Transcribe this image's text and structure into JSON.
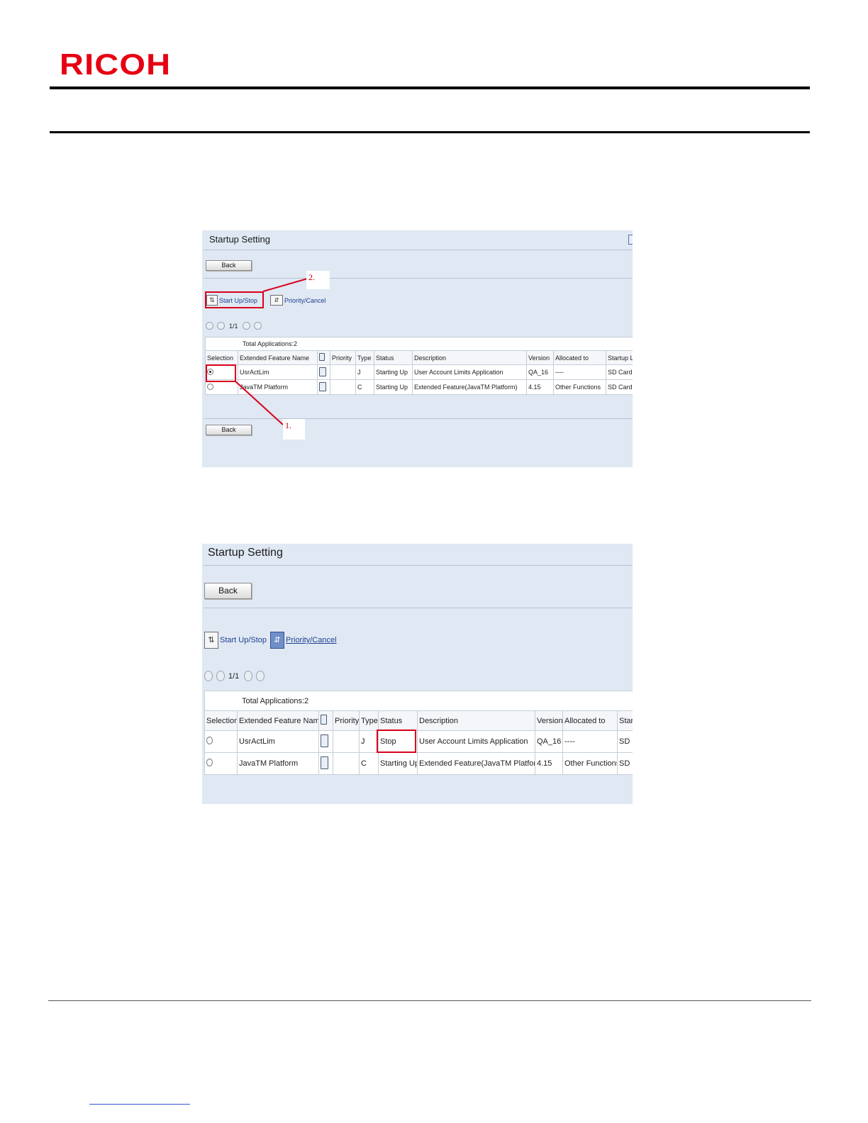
{
  "brand": {
    "logo_text": "RICOH"
  },
  "screens": [
    {
      "title": "Startup Setting",
      "back_top": "Back",
      "back_bottom": "Back",
      "toolbar": {
        "start_stop": "Start Up/Stop",
        "priority_cancel": "Priority/Cancel"
      },
      "pager": "1/1",
      "total": "Total Applications:2",
      "headers": [
        "Selection",
        "Extended Feature Name",
        "",
        "Priority",
        "Type",
        "Status",
        "Description",
        "Version",
        "Allocated to",
        "Startup L"
      ],
      "rows": [
        {
          "selected": true,
          "name": "UsrActLim",
          "priority": "",
          "type": "J",
          "status": "Starting Up",
          "description": "User Account Limits Application",
          "version": "QA_16",
          "allocated": "----",
          "startup": "SD Card"
        },
        {
          "selected": false,
          "name": "JavaTM Platform",
          "priority": "",
          "type": "C",
          "status": "Starting Up",
          "description": "Extended Feature(JavaTM Platform)",
          "version": "4.15",
          "allocated": "Other Functions",
          "startup": "SD Card"
        }
      ],
      "callouts": [
        "2.",
        "1."
      ]
    },
    {
      "title": "Startup Setting",
      "back_top": "Back",
      "toolbar": {
        "start_stop": "Start Up/Stop",
        "priority_cancel": "Priority/Cancel"
      },
      "pager": "1/1",
      "total": "Total Applications:2",
      "headers": [
        "Selection",
        "Extended Feature Name",
        "",
        "Priority",
        "Type",
        "Status",
        "Description",
        "Version",
        "Allocated to",
        "Start"
      ],
      "rows": [
        {
          "selected": false,
          "name": "UsrActLim",
          "priority": "",
          "type": "J",
          "status": "Stop",
          "description": "User Account Limits Application",
          "version": "QA_16",
          "allocated": "----",
          "startup": "SD C"
        },
        {
          "selected": false,
          "name": "JavaTM Platform",
          "priority": "",
          "type": "C",
          "status": "Starting Up",
          "description": "Extended Feature(JavaTM Platform)",
          "version": "4.15",
          "allocated": "Other Functions",
          "startup": "SD C"
        }
      ]
    }
  ],
  "colors": {
    "brand_red": "#e60012",
    "highlight_red": "#d9001b",
    "panel_bg": "#dfe8f3",
    "link_blue": "#1f3f8f"
  }
}
